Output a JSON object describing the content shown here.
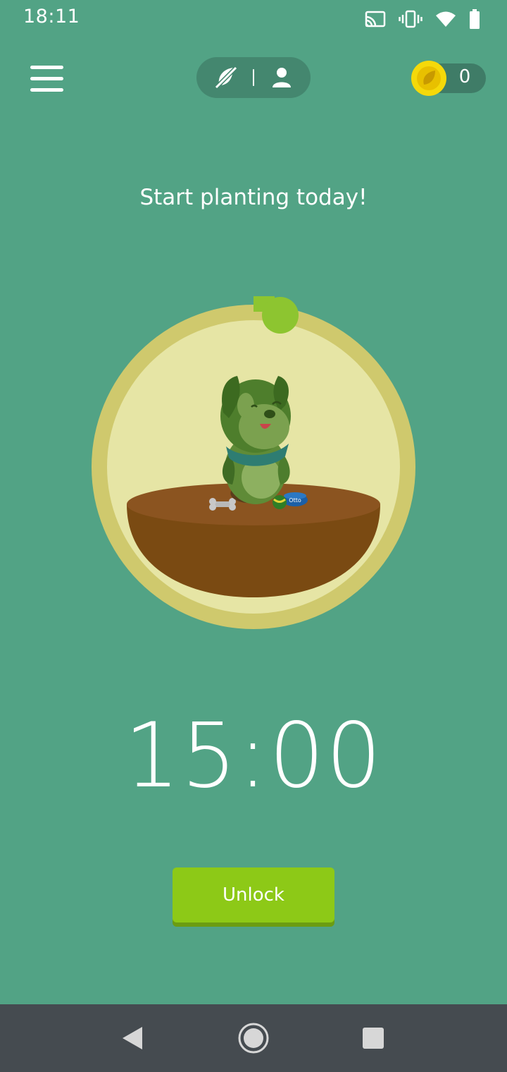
{
  "status_bar": {
    "time": "18:11",
    "icons": [
      "cast-icon",
      "vibrate-icon",
      "wifi-icon",
      "battery-icon"
    ]
  },
  "header": {
    "menu_icon": "hamburger-menu-icon",
    "mode_toggle": {
      "left_icon": "no-phone-leaf-icon",
      "right_icon": "person-icon"
    },
    "coins": {
      "icon": "coin-icon",
      "count": "0",
      "coin_color": "#f5d90a"
    }
  },
  "main": {
    "title": "Start planting today!",
    "timer": "15:00",
    "progress_fraction": 0,
    "pet_bowl_label": "Otto",
    "unlock_label": "Unlock"
  },
  "nav_bar": {
    "back_icon": "back-triangle-icon",
    "home_icon": "home-circle-icon",
    "recents_icon": "recents-square-icon"
  },
  "colors": {
    "background": "#52a385",
    "ring": "#cfc96d",
    "ring_inner": "#e6e5a5",
    "accent_green": "#8dc917",
    "soil": "#7a4a12"
  }
}
